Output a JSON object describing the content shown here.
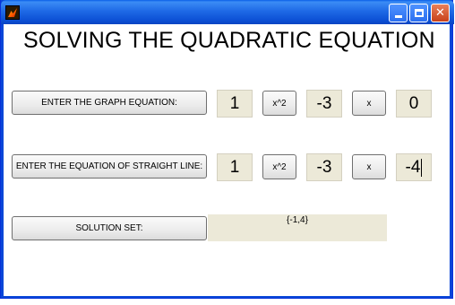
{
  "window": {
    "title": "",
    "icon": "matlab-icon",
    "buttons": [
      "minimize",
      "maximize",
      "close"
    ]
  },
  "heading": "SOLVING THE QUADRATIC EQUATION",
  "graph_row": {
    "label": "ENTER THE GRAPH EQUATION:",
    "a": "1",
    "x2_label": "x^2",
    "b": "-3",
    "x_label": "x",
    "c": "0"
  },
  "line_row": {
    "label": "ENTER THE EQUATION OF STRAIGHT LINE:",
    "a": "1",
    "x2_label": "x^2",
    "b": "-3",
    "x_label": "x",
    "c": "-4"
  },
  "solution": {
    "label": "SOLUTION SET:",
    "value": "{-1,4}"
  },
  "colors": {
    "titlebar": "#0b4fd4",
    "edit_bg": "#ece9d8",
    "close_button": "#c8411a"
  }
}
